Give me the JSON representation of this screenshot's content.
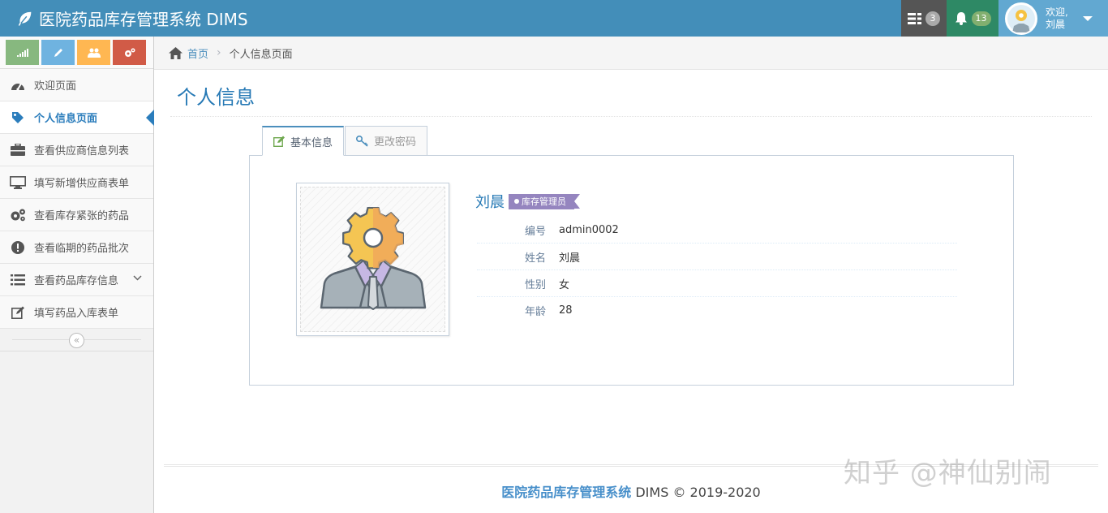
{
  "navbar": {
    "brand": "医院药品库存管理系统 DIMS",
    "tasks_count": "3",
    "notifications_count": "13",
    "welcome": "欢迎,",
    "user_name": "刘晨"
  },
  "sidebar": {
    "items": [
      {
        "label": "欢迎页面"
      },
      {
        "label": "个人信息页面"
      },
      {
        "label": "查看供应商信息列表"
      },
      {
        "label": "填写新增供应商表单"
      },
      {
        "label": "查看库存紧张的药品"
      },
      {
        "label": "查看临期的药品批次"
      },
      {
        "label": "查看药品库存信息"
      },
      {
        "label": "填写药品入库表单"
      }
    ],
    "collapse_glyph": "«"
  },
  "breadcrumb": {
    "home": "首页",
    "current": "个人信息页面"
  },
  "page": {
    "title": "个人信息"
  },
  "tabs": [
    {
      "label": "基本信息"
    },
    {
      "label": "更改密码"
    }
  ],
  "profile": {
    "name": "刘晨",
    "role": "库存管理员",
    "fields": [
      {
        "label": "编号",
        "value": "admin0002"
      },
      {
        "label": "姓名",
        "value": "刘晨"
      },
      {
        "label": "性别",
        "value": "女"
      },
      {
        "label": "年龄",
        "value": "28"
      }
    ]
  },
  "footer": {
    "brand": "医院药品库存管理系统",
    "rest": " DIMS © 2019-2020"
  },
  "watermark": "知乎 @神仙别闹",
  "colors": {
    "navbar": "#438eb9",
    "accent": "#2679b5",
    "role_tag": "#9585bf"
  }
}
